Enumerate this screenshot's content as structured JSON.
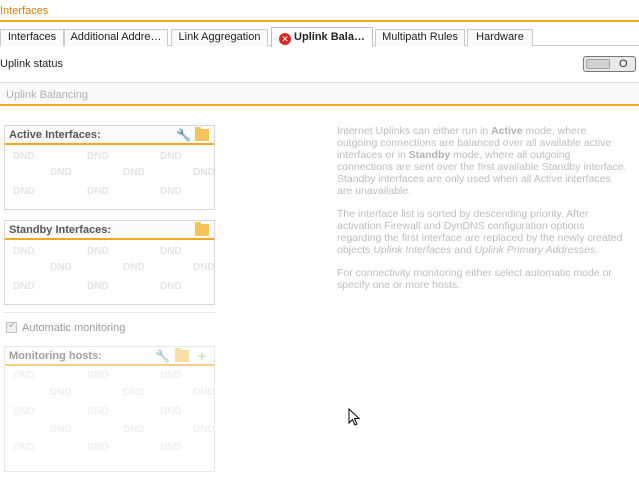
{
  "page_title": "Interfaces",
  "tabs": [
    {
      "label": "Interfaces",
      "active": false
    },
    {
      "label": "Additional Addre…",
      "active": false
    },
    {
      "label": "Link Aggregation",
      "active": false
    },
    {
      "label": "Uplink Bala…",
      "active": true,
      "error": true
    },
    {
      "label": "Multipath Rules",
      "active": false
    },
    {
      "label": "Hardware",
      "active": false
    }
  ],
  "uplink_status": {
    "label": "Uplink status",
    "toggle_state": "O"
  },
  "section": {
    "title": "Uplink Balancing"
  },
  "active_interfaces": {
    "title": "Active Interfaces:",
    "placeholder": "DND"
  },
  "standby_interfaces": {
    "title": "Standby Interfaces:",
    "placeholder": "DND"
  },
  "automatic_monitoring": {
    "label": "Automatic monitoring",
    "checked": true
  },
  "monitoring_hosts": {
    "title": "Monitoring hosts:",
    "placeholder": "DND"
  },
  "help": {
    "p1_a": "Internet Uplinks can either run in ",
    "p1_active": "Active",
    "p1_b": " mode, where outgoing connections are balanced over all available active interfaces or in ",
    "p1_standby": "Standby",
    "p1_c": " mode, where all outgoing connections are sent over the first available Standby interface. Standby interfaces are only used when all Active interfaces are unavailable.",
    "p2_a": "The interface list is sorted by descending priority. After activation Firewall and DynDNS configuration options regarding the first interface are replaced by the newly created objects ",
    "p2_obj1": "Uplink Interfaces",
    "p2_and": " and ",
    "p2_obj2": "Uplink Primary Addresses",
    "p2_end": ".",
    "p3": "For connectivity monitoring either select automatic mode or specify one or more hosts."
  },
  "colors": {
    "accent": "#f5a623",
    "title_text": "#e07b00",
    "error": "#d9261c"
  }
}
